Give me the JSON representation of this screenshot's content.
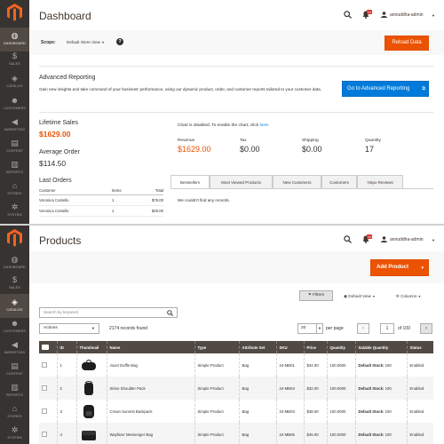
{
  "nav": {
    "items": [
      {
        "label": "Dashboard",
        "icon": "dashboard-icon",
        "glyph": "◍"
      },
      {
        "label": "Sales",
        "icon": "dollar-icon",
        "glyph": "$"
      },
      {
        "label": "Catalog",
        "icon": "cube-icon",
        "glyph": "◈"
      },
      {
        "label": "Customers",
        "icon": "person-icon",
        "glyph": "☻"
      },
      {
        "label": "Marketing",
        "icon": "megaphone-icon",
        "glyph": "◀"
      },
      {
        "label": "Content",
        "icon": "layout-icon",
        "glyph": "▤"
      },
      {
        "label": "Reports",
        "icon": "bar-chart-icon",
        "glyph": "▥"
      },
      {
        "label": "Stores",
        "icon": "store-icon",
        "glyph": "⌂"
      },
      {
        "label": "System",
        "icon": "gear-icon",
        "glyph": "✲"
      }
    ]
  },
  "header": {
    "user": "aniruddha-admin",
    "notifications": "10"
  },
  "dashboard": {
    "title": "Dashboard",
    "scope_label": "Scope:",
    "scope_value": "Default Store View",
    "reload_label": "Reload Data",
    "advanced_title": "Advanced Reporting",
    "advanced_desc": "Gain new insights and take command of your business' performance, using our dynamic product, order, and customer reports tailored to your customer data.",
    "advanced_button": "Go to Advanced Reporting",
    "lifetime_sales_label": "Lifetime Sales",
    "lifetime_sales_value": "$1629.00",
    "average_order_label": "Average Order",
    "average_order_value": "$114.50",
    "chart_msg": "Chart is disabled. To enable the chart, click ",
    "chart_link": "here.",
    "totals": [
      {
        "label": "Revenue",
        "value": "$1629.00"
      },
      {
        "label": "Tax",
        "value": "$0.00"
      },
      {
        "label": "Shipping",
        "value": "$0.00"
      },
      {
        "label": "Quantity",
        "value": "17"
      }
    ],
    "last_orders_title": "Last Orders",
    "last_orders_headers": [
      "Customer",
      "Items",
      "Total"
    ],
    "last_orders": [
      {
        "customer": "Veronica Costello",
        "items": "1",
        "total": "$78.00"
      },
      {
        "customer": "Veronica Costello",
        "items": "1",
        "total": "$29.00"
      }
    ],
    "tabs": [
      "Bestsellers",
      "Most Viewed Products",
      "New Customers",
      "Customers",
      "Yotpo Reviews"
    ],
    "no_records": "We couldn't find any records."
  },
  "products": {
    "title": "Products",
    "add_label": "Add Product",
    "filters_label": "Filters",
    "default_view": "Default View",
    "columns_label": "Columns",
    "search_placeholder": "Search by keyword",
    "actions_label": "Actions",
    "records": "2174 records found",
    "per_page_value": "20",
    "per_page_label": "per page",
    "page_value": "1",
    "of_pages": "of 109",
    "columns": [
      "ID",
      "Thumbnail",
      "Name",
      "Type",
      "Attribute Set",
      "SKU",
      "Price",
      "Quantity",
      "Salable Quantity",
      "Status"
    ],
    "rows": [
      {
        "id": "1",
        "name": "Joust Duffle Bag",
        "type": "Simple Product",
        "attr": "Bag",
        "sku": "24-MB01",
        "price": "$34.00",
        "qty": "100.0000",
        "salable_label": "Default Stock:",
        "salable_value": "100",
        "status": "Enabled"
      },
      {
        "id": "2",
        "name": "Strive Shoulder Pack",
        "type": "Simple Product",
        "attr": "Bag",
        "sku": "24-MB04",
        "price": "$32.00",
        "qty": "100.0000",
        "salable_label": "Default Stock:",
        "salable_value": "100",
        "status": "Enabled"
      },
      {
        "id": "3",
        "name": "Crown Summit Backpack",
        "type": "Simple Product",
        "attr": "Bag",
        "sku": "24-MB03",
        "price": "$38.00",
        "qty": "100.0000",
        "salable_label": "Default Stock:",
        "salable_value": "100",
        "status": "Enabled"
      },
      {
        "id": "4",
        "name": "Wayfarer Messenger Bag",
        "type": "Simple Product",
        "attr": "Bag",
        "sku": "24-MB05",
        "price": "$45.00",
        "qty": "100.0000",
        "salable_label": "Default Stock:",
        "salable_value": "100",
        "status": "Enabled"
      }
    ]
  },
  "colors": {
    "sidebar": "#373330",
    "accent_orange": "#eb5202",
    "link_blue": "#007bdb",
    "grid_header": "#514943"
  }
}
